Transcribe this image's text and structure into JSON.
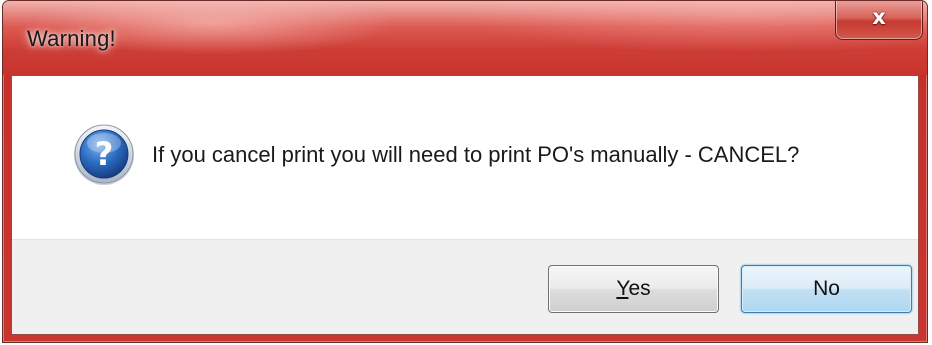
{
  "window": {
    "title": "Warning!",
    "close_symbol": "x"
  },
  "message": {
    "icon": "question-icon",
    "text": "If you cancel print you will need to print PO's manually - CANCEL?"
  },
  "buttons": {
    "yes_mnemonic": "Y",
    "yes_rest": "es",
    "no_label": "No"
  },
  "colors": {
    "title_bar": "#c8342d",
    "button_area": "#f0f0f0",
    "default_button": "#aed6f1",
    "icon_blue": "#1f5fb4"
  }
}
